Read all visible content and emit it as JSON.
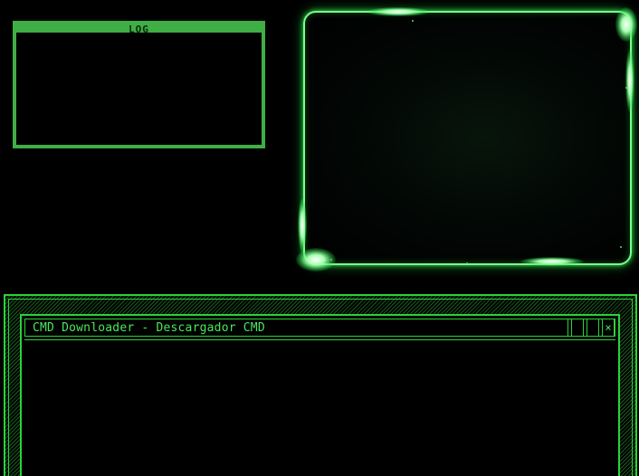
{
  "log_panel": {
    "title": "LOG"
  },
  "main_window": {
    "title": "CMD Downloader - Descargador CMD",
    "buttons": {
      "minimize_label": "",
      "maximize_label": "",
      "close_label": "×"
    }
  },
  "colors": {
    "background": "#000000",
    "accent_green": "#2bd13a",
    "log_green": "#3fae45",
    "glow_green": "#7dff8c"
  },
  "icons": {
    "close": "close-icon"
  }
}
